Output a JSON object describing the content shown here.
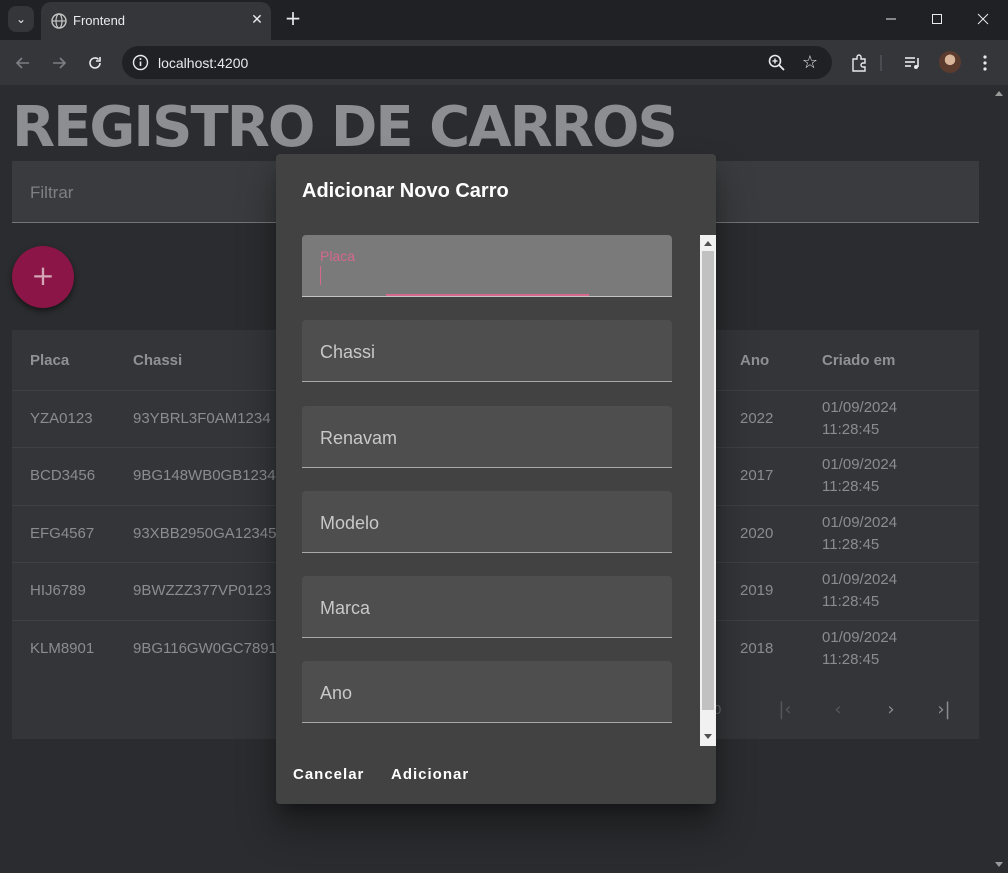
{
  "browser": {
    "tab_title": "Frontend",
    "url": "localhost:4200"
  },
  "page": {
    "heading": "REGISTRO DE CARROS",
    "filter_placeholder": "Filtrar",
    "fab_label": "+",
    "table": {
      "headers": [
        "Placa",
        "Chassi",
        "Ano",
        "Criado em"
      ],
      "rows": [
        {
          "placa": "YZA0123",
          "chassi": "93YBRL3F0AM1234",
          "ano": "2022",
          "criado_date": "01/09/2024",
          "criado_time": "11:28:45"
        },
        {
          "placa": "BCD3456",
          "chassi": "9BG148WB0GB1234",
          "ano": "2017",
          "criado_date": "01/09/2024",
          "criado_time": "11:28:45"
        },
        {
          "placa": "EFG4567",
          "chassi": "93XBB2950GA12345",
          "ano": "2020",
          "criado_date": "01/09/2024",
          "criado_time": "11:28:45"
        },
        {
          "placa": "HIJ6789",
          "chassi": "9BWZZZ377VP0123",
          "ano": "2019",
          "criado_date": "01/09/2024",
          "criado_time": "11:28:45"
        },
        {
          "placa": "KLM8901",
          "chassi": "9BG116GW0GC7891",
          "ano": "2018",
          "criado_date": "01/09/2024",
          "criado_time": "11:28:45"
        }
      ],
      "paginator_fragment": "0"
    }
  },
  "dialog": {
    "title": "Adicionar Novo Carro",
    "fields": [
      "Placa",
      "Chassi",
      "Renavam",
      "Modelo",
      "Marca",
      "Ano"
    ],
    "cancel_label": "Cancelar",
    "add_label": "Adicionar"
  },
  "colors": {
    "accent": "#d4688f",
    "fab": "#8a1546",
    "dialog_bg": "#424242"
  }
}
